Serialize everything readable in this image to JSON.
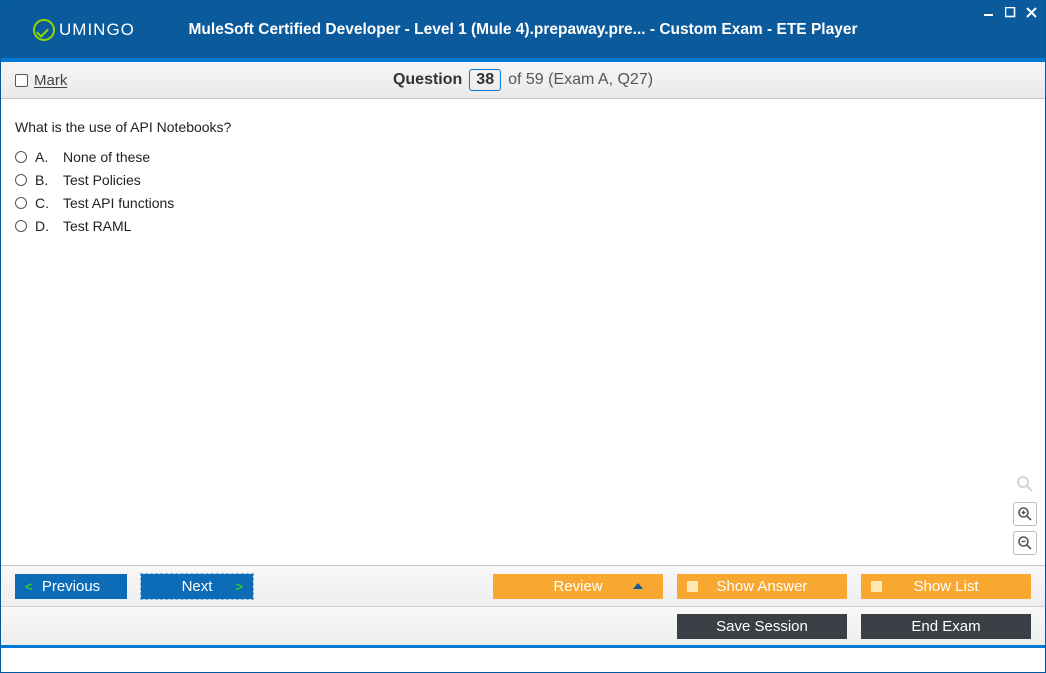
{
  "titlebar": {
    "logo_text": "UMINGO",
    "title": "MuleSoft Certified Developer - Level 1 (Mule 4).prepaway.pre... - Custom Exam - ETE Player"
  },
  "subbar": {
    "mark_label": "Mark",
    "question_word": "Question",
    "current_number": "38",
    "suffix": "of 59 (Exam A, Q27)"
  },
  "question": {
    "text": "What is the use of API Notebooks?",
    "options": [
      {
        "letter": "A.",
        "text": "None of these"
      },
      {
        "letter": "B.",
        "text": "Test Policies"
      },
      {
        "letter": "C.",
        "text": "Test API functions"
      },
      {
        "letter": "D.",
        "text": "Test RAML"
      }
    ]
  },
  "buttons": {
    "previous": "Previous",
    "next": "Next",
    "review": "Review",
    "show_answer": "Show Answer",
    "show_list": "Show List",
    "save_session": "Save Session",
    "end_exam": "End Exam"
  }
}
